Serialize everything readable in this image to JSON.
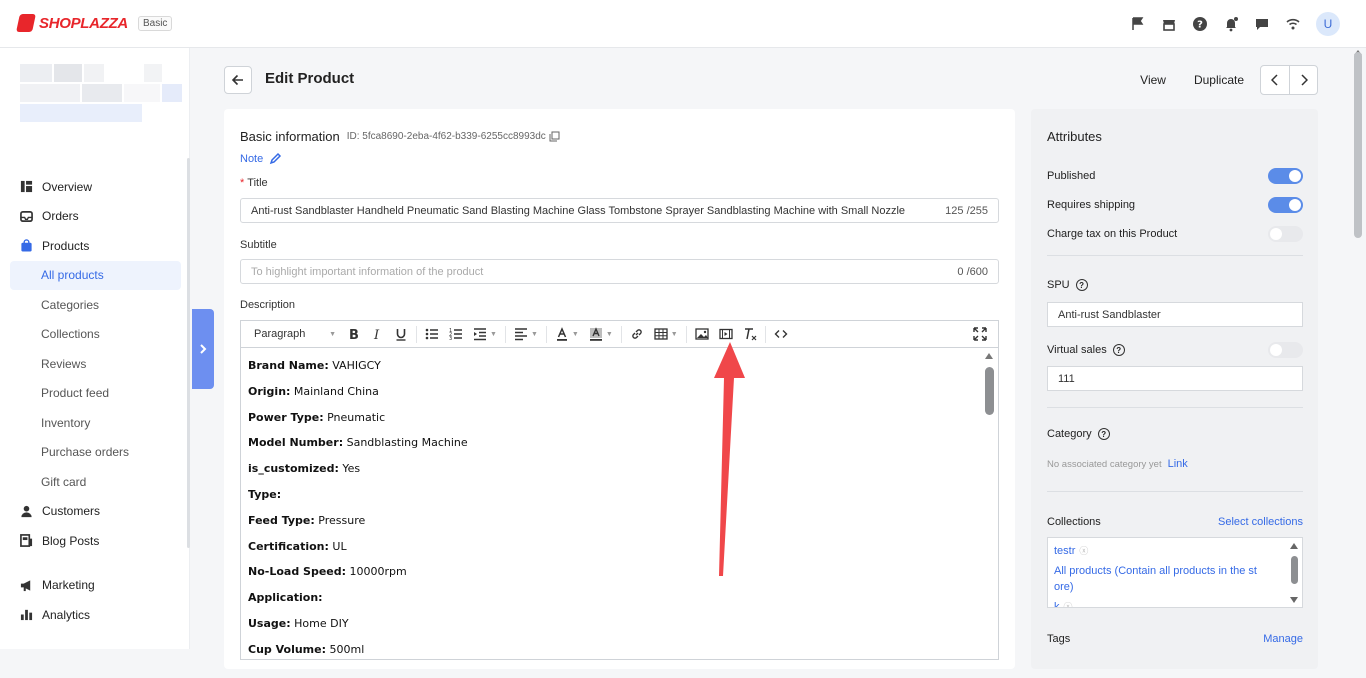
{
  "app": {
    "logo_text": "SHOPLAZZA",
    "plan_badge": "Basic",
    "brand_color": "#e8262b",
    "accent_color": "#356ae6"
  },
  "topbar": {
    "icons": [
      "flag-icon",
      "store-icon",
      "help-icon",
      "bell-icon",
      "chat-icon",
      "wifi-icon"
    ],
    "avatar_letter": "U"
  },
  "sidebar": {
    "items": [
      {
        "label": "Overview",
        "icon": "dashboard-icon"
      },
      {
        "label": "Orders",
        "icon": "inbox-icon"
      },
      {
        "label": "Products",
        "icon": "bag-icon"
      },
      {
        "label": "All products",
        "sub": true,
        "active": true
      },
      {
        "label": "Categories",
        "sub": true
      },
      {
        "label": "Collections",
        "sub": true
      },
      {
        "label": "Reviews",
        "sub": true
      },
      {
        "label": "Product feed",
        "sub": true
      },
      {
        "label": "Inventory",
        "sub": true
      },
      {
        "label": "Purchase orders",
        "sub": true
      },
      {
        "label": "Gift card",
        "sub": true
      },
      {
        "label": "Customers",
        "icon": "user-icon"
      },
      {
        "label": "Blog Posts",
        "icon": "blog-icon"
      },
      {
        "label": "Marketing",
        "icon": "megaphone-icon"
      },
      {
        "label": "Analytics",
        "icon": "bar-chart-icon"
      }
    ]
  },
  "page": {
    "title": "Edit Product",
    "actions": {
      "view": "View",
      "duplicate": "Duplicate"
    }
  },
  "basic": {
    "section_title": "Basic information",
    "id_text": "ID: 5fca8690-2eba-4f62-b339-6255cc8993dc",
    "note_label": "Note",
    "title_label": "Title",
    "title_value": "Anti-rust Sandblaster Handheld Pneumatic Sand Blasting Machine Glass Tombstone Sprayer Sandblasting Machine with Small Nozzle",
    "title_count": "125 /255",
    "subtitle_label": "Subtitle",
    "subtitle_placeholder": "To highlight important information of the product",
    "subtitle_count": "0 /600",
    "description_label": "Description"
  },
  "editor": {
    "paragraph_select": "Paragraph",
    "specs": [
      {
        "key": "Brand Name:",
        "value": "VAHIGCY"
      },
      {
        "key": "Origin:",
        "value": "Mainland China"
      },
      {
        "key": "Power Type:",
        "value": "Pneumatic"
      },
      {
        "key": "Model Number:",
        "value": "Sandblasting Machine"
      },
      {
        "key": "is_customized:",
        "value": "Yes"
      },
      {
        "key": "Type:",
        "value": ""
      },
      {
        "key": "Feed Type:",
        "value": "Pressure"
      },
      {
        "key": "Certification:",
        "value": "UL"
      },
      {
        "key": "No-Load Speed:",
        "value": "10000rpm"
      },
      {
        "key": "Application:",
        "value": ""
      },
      {
        "key": "Usage:",
        "value": "Home DIY"
      },
      {
        "key": "Cup Volume:",
        "value": "500ml"
      }
    ]
  },
  "attributes": {
    "title": "Attributes",
    "published_label": "Published",
    "published": true,
    "requires_shipping_label": "Requires shipping",
    "requires_shipping": true,
    "charge_tax_label": "Charge tax on this Product",
    "charge_tax": false,
    "spu_label": "SPU",
    "spu_value": "Anti-rust Sandblaster",
    "virtual_sales_label": "Virtual sales",
    "virtual_sales_enabled": false,
    "virtual_sales_value": "111",
    "category_label": "Category",
    "category_empty": "No associated category yet",
    "category_link": "Link",
    "collections_label": "Collections",
    "collections_link": "Select collections",
    "collections": [
      {
        "name": "testr"
      },
      {
        "name": "All products  (Contain all products in the st ore)"
      },
      {
        "name": "k"
      }
    ],
    "tags_label": "Tags",
    "tags_link": "Manage"
  }
}
